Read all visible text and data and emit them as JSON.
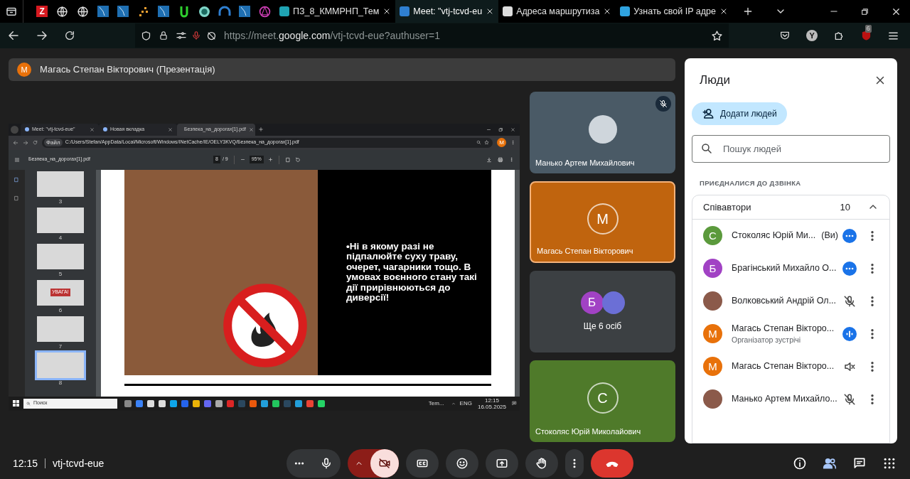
{
  "browser": {
    "pinned_tabs": [
      {
        "kind": "letter",
        "label": "Z"
      },
      {
        "kind": "globe"
      },
      {
        "kind": "globe"
      },
      {
        "kind": "tile"
      },
      {
        "kind": "tile"
      },
      {
        "kind": "dots"
      },
      {
        "kind": "tile"
      },
      {
        "kind": "green"
      },
      {
        "kind": "circle"
      },
      {
        "kind": "arch"
      },
      {
        "kind": "tile"
      },
      {
        "kind": "star"
      }
    ],
    "tabs": [
      {
        "title": "ПЗ_8_КММРНП_Тем",
        "selected": false
      },
      {
        "title": "Meet: \"vtj-tcvd-eu",
        "selected": true
      },
      {
        "title": "Адреса маршрутиза",
        "selected": false
      },
      {
        "title": "Узнать свой IP адре",
        "selected": false
      }
    ],
    "profile_letter": "Y",
    "url_prefix": "https://meet.",
    "url_domain": "google.com",
    "url_path": "/vtj-tcvd-eue?authuser=1",
    "extension_badge": "6"
  },
  "presenter_bar": {
    "initial": "М",
    "label": "Магась Степан Вікторович (Презентація)"
  },
  "shared_screen": {
    "tabs": [
      {
        "title": "Meet: \"vtj-tcvd-eue\"",
        "selected": false
      },
      {
        "title": "Новая вкладка",
        "selected": false
      },
      {
        "title": "Безпека_на_дорогах[1].pdf",
        "selected": true
      }
    ],
    "file_chip": "Файл",
    "path": "C:/Users/Stefan/AppData/Local/Microsoft/Windows/INetCache/IE/OELY3KVQ/Безпека_на_дорогах[1].pdf",
    "profile_initial": "М",
    "pdf_title": "Безпека_на_дорогах[1].pdf",
    "page": "8",
    "page_total": "/ 9",
    "zoom": "95%",
    "thumbnails": [
      {
        "number": "3",
        "selected": false
      },
      {
        "number": "4",
        "selected": false
      },
      {
        "number": "5",
        "selected": false
      },
      {
        "number": "6",
        "caption": "УВАГА!",
        "selected": false
      },
      {
        "number": "7",
        "selected": false
      },
      {
        "number": "8",
        "selected": true
      }
    ],
    "slide_text": "•Ні в якому разі не підпалюйте суху траву, очерет, чагарники тощо. В умовах воєнного стану такі дії прирівнюються до диверсії!",
    "taskbar": {
      "search_placeholder": "Поиск",
      "weather": "Tem...",
      "language": "ENG",
      "time": "12:15",
      "date": "16.05.2025"
    }
  },
  "tiles": [
    {
      "kind": "video",
      "name": "Манько Артем Михайлович",
      "muted": true,
      "speaking": false,
      "color": "#4a5a66"
    },
    {
      "kind": "avatar",
      "initial": "М",
      "name": "Магась Степан Вікторович",
      "muted": false,
      "speaking": true,
      "color": "#c0640e"
    },
    {
      "kind": "more",
      "initials": [
        "Б"
      ],
      "label": "Ще 6 осіб",
      "muted": false,
      "speaking": false,
      "color": "#3c4043"
    },
    {
      "kind": "avatar",
      "initial": "С",
      "name": "Стоколяс Юрій Миколайович",
      "muted": false,
      "speaking": false,
      "color": "#4f7a2a"
    }
  ],
  "people_panel": {
    "title": "Люди",
    "add_button": "Додати людей",
    "search_placeholder": "Пошук людей",
    "section": "ПРИЄДНАЛИСЯ ДО ДЗВІНКА",
    "group": {
      "label": "Співавтори",
      "count": "10",
      "expanded": true
    },
    "people": [
      {
        "kind": "more",
        "initial": "С",
        "color": "#5b9a3c",
        "name": "Стоколяс Юрій Ми...",
        "suffix": "(Ви)"
      },
      {
        "kind": "more",
        "initial": "Б",
        "color": "#a142c4",
        "name": "Брагінський Михайло О..."
      },
      {
        "kind": "muted",
        "name": "Волковський Андрій Ол..."
      },
      {
        "kind": "speaking",
        "initial": "М",
        "color": "#e8710a",
        "name": "Магась Степан Вікторо...",
        "subtitle": "Організатор зустрічі"
      },
      {
        "kind": "sound_off",
        "initial": "М",
        "color": "#e8710a",
        "name": "Магась Степан Вікторо..."
      },
      {
        "kind": "muted",
        "name": "Манько Артем Михайло..."
      }
    ]
  },
  "bottom_bar": {
    "time": "12:15",
    "meeting_code": "vtj-tcvd-eue",
    "controls": [
      {
        "kind": "more_options"
      },
      {
        "kind": "mic",
        "on": true
      },
      {
        "kind": "camera",
        "on": false
      },
      {
        "kind": "captions"
      },
      {
        "kind": "emoji"
      },
      {
        "kind": "present"
      },
      {
        "kind": "hand"
      },
      {
        "kind": "menu"
      },
      {
        "kind": "hangup"
      }
    ],
    "side": [
      {
        "kind": "info",
        "selected": false
      },
      {
        "kind": "people",
        "selected": true
      },
      {
        "kind": "chat",
        "selected": false
      },
      {
        "kind": "apps",
        "selected": false
      }
    ]
  }
}
